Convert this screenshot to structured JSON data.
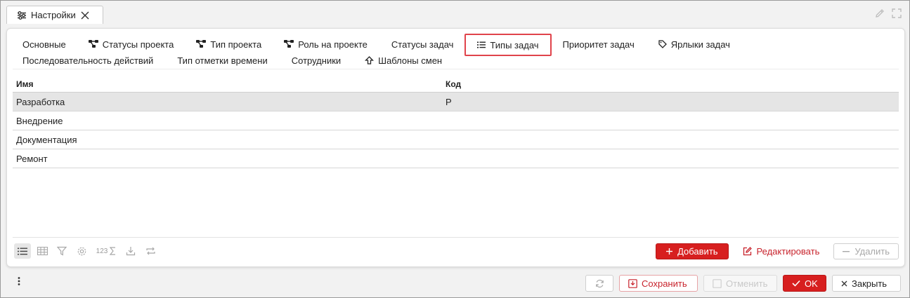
{
  "window": {
    "tab_title": "Настройки"
  },
  "tabs_row1": [
    {
      "label": "Основные",
      "icon": ""
    },
    {
      "label": "Статусы проекта",
      "icon": "hierarchy-icon"
    },
    {
      "label": "Тип проекта",
      "icon": "hierarchy-icon"
    },
    {
      "label": "Роль на проекте",
      "icon": "hierarchy-icon"
    },
    {
      "label": "Статусы задач",
      "icon": ""
    },
    {
      "label": "Типы задач",
      "icon": "list-icon",
      "active": true
    },
    {
      "label": "Приоритет задач",
      "icon": ""
    },
    {
      "label": "Ярлыки задач",
      "icon": "tag-icon"
    }
  ],
  "tabs_row2": [
    {
      "label": "Последовательность действий",
      "icon": ""
    },
    {
      "label": "Тип отметки времени",
      "icon": ""
    },
    {
      "label": "Сотрудники",
      "icon": ""
    },
    {
      "label": "Шаблоны смен",
      "icon": "cloud-upload-icon"
    }
  ],
  "table": {
    "columns": [
      "Имя",
      "Код"
    ],
    "rows": [
      {
        "name": "Разработка",
        "code": "P",
        "selected": true
      },
      {
        "name": "Внедрение",
        "code": ""
      },
      {
        "name": "Документация",
        "code": ""
      },
      {
        "name": "Ремонт",
        "code": ""
      }
    ]
  },
  "toolbar": {
    "count_label": "123"
  },
  "actions": {
    "add": "Добавить",
    "edit": "Редактировать",
    "delete": "Удалить"
  },
  "bottom": {
    "save": "Сохранить",
    "cancel": "Отменить",
    "ok": "OK",
    "close": "Закрыть"
  },
  "colors": {
    "accent": "#d71f1f",
    "active_tab_border": "#e0434b",
    "selected_row": "#e5e5e5"
  }
}
